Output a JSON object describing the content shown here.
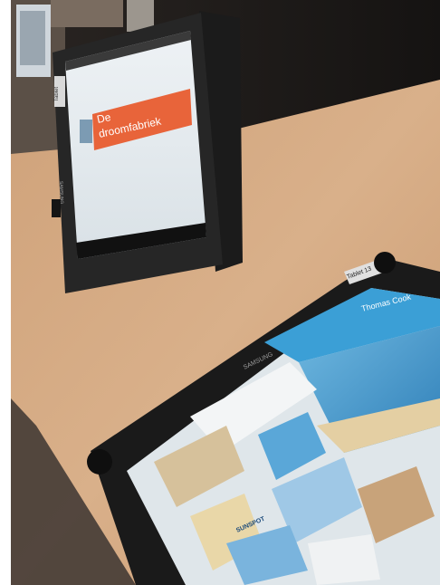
{
  "photo": {
    "upper_tablet": {
      "brand": "SAMSUNG",
      "case_tag": "Tablet",
      "slide_title_line1": "De",
      "slide_title_line2": "droomfabriek"
    },
    "lower_tablet": {
      "brand": "SAMSUNG",
      "case_tag": "Tablet 13",
      "site_name": "Thomas Cook",
      "brochure_name": "SUNSPOT"
    }
  },
  "colors": {
    "table": "#d8ae86",
    "wall": "#1f1c1a",
    "slide_banner": "#e8643a",
    "site_header": "#3b9fd6"
  }
}
